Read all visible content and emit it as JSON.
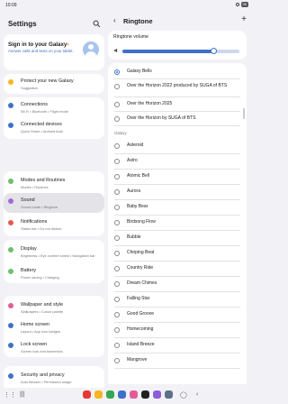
{
  "status": {
    "time": "10:09",
    "battery": "96"
  },
  "left": {
    "title": "Settings",
    "signin": {
      "title_a": "Sign in to your Galaxy",
      "title_b": "",
      "subtitle": "Answer calls and texts on your tablet."
    },
    "items": [
      {
        "title": "Protect your new Galaxy",
        "sub": "Suggestion",
        "color": "#f5b623"
      },
      {
        "title": "Connections",
        "sub": "Wi-Fi • Bluetooth • Flight mode",
        "color": "#3e72c9"
      },
      {
        "title": "Connected devices",
        "sub": "Quick Share • Android Auto",
        "color": "#3e72c9"
      },
      {
        "title": "Modes and Routines",
        "sub": "Modes • Routines",
        "color": "#6dc06b"
      },
      {
        "title": "Sound",
        "sub": "Sound mode • Ringtone",
        "color": "#a46ad6"
      },
      {
        "title": "Notifications",
        "sub": "Status bar • Do not disturb",
        "color": "#e55b4e"
      },
      {
        "title": "Display",
        "sub": "Brightness • Eye comfort shield • Navigation bar",
        "color": "#6dc06b"
      },
      {
        "title": "Battery",
        "sub": "Power saving • Charging",
        "color": "#6dc06b"
      },
      {
        "title": "Wallpaper and style",
        "sub": "Wallpapers • Colour palette",
        "color": "#e55b99"
      },
      {
        "title": "Home screen",
        "sub": "Layout • App icon badges",
        "color": "#3e72c9"
      },
      {
        "title": "Lock screen",
        "sub": "Screen lock and biometrics",
        "color": "#3e72c9"
      },
      {
        "title": "Security and privacy",
        "sub": "Auto Blocker • Permission usage",
        "color": "#3e72c9"
      }
    ]
  },
  "right": {
    "title": "Ringtone",
    "volume_label": "Ringtone volume",
    "volume_level": 0.78,
    "accent": "#3e72c9",
    "options": [
      "Galaxy Bells",
      "Over the Horizon 2022 produced by SUGA of BTS",
      "Over the Horizon 2025",
      "Over the Horizon by SUGA of BTS"
    ],
    "selected_index": 0,
    "section_label": "Galaxy",
    "galaxy": [
      "Asteroid",
      "Astro",
      "Atomic Bell",
      "Aurora",
      "Baby Bear",
      "Birdsong Flow",
      "Bubble",
      "Chirping Beat",
      "Country Ride",
      "Dream Chimes",
      "Falling Star",
      "Good Groove",
      "Homecoming",
      "Island Breeze",
      "Mangrove"
    ]
  },
  "dock": {
    "apps": [
      "#e53935",
      "#f5b623",
      "#34a853",
      "#3e72c9",
      "#e55b99",
      "#222222",
      "#8e5bd6",
      "#5e6f8a"
    ]
  }
}
